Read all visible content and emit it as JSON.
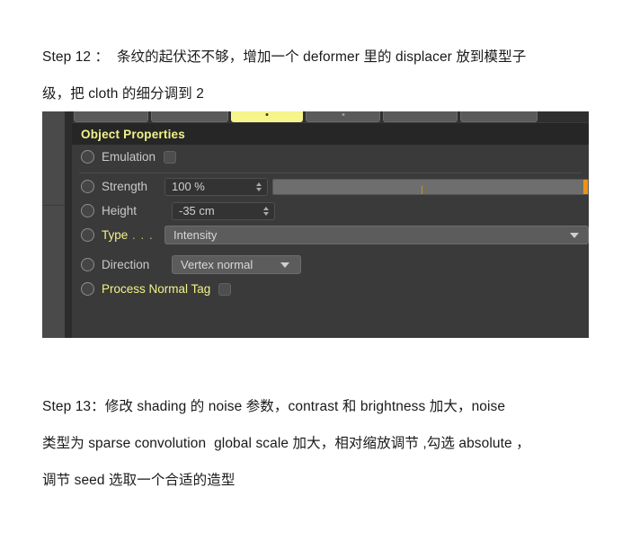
{
  "document": {
    "step12": "Step 12 ：  条纹的起伏还不够，增加一个 deformer 里的 displacer 放到模型子\n级，把 cloth 的细分调到 2",
    "step13": "Step 13：修改 shading 的 noise 参数，contrast 和 brightness 加大，noise\n类型为 sparse convolution  global scale 加大，相对缩放调节 ,勾选 absolute ，\n调节 seed 选取一个合适的造型"
  },
  "panel": {
    "section_title": "Object Properties",
    "tabs": [
      {
        "name": "tab-1",
        "active": false,
        "marker": "none"
      },
      {
        "name": "tab-2",
        "active": false,
        "marker": "none"
      },
      {
        "name": "tab-3",
        "active": true,
        "marker": "dark-dot"
      },
      {
        "name": "tab-4",
        "active": false,
        "marker": "light-dot"
      },
      {
        "name": "tab-5",
        "active": false,
        "marker": "none"
      },
      {
        "name": "tab-6",
        "active": false,
        "marker": "none"
      }
    ],
    "rows": {
      "emulation": {
        "label": "Emulation",
        "checkbox_checked": false,
        "icon": "animation-track-circle-icon"
      },
      "strength": {
        "label": "Strength",
        "value": "100 %",
        "slider_percent": 100,
        "icon": "animation-track-circle-icon"
      },
      "height": {
        "label": "Height",
        "value": "-35 cm",
        "icon": "animation-track-circle-icon"
      },
      "type": {
        "label": "Type",
        "label_suffix_dots": true,
        "value": "Intensity",
        "icon": "animation-track-circle-icon"
      },
      "direction": {
        "label": "Direction",
        "value": "Vertex normal",
        "icon": "animation-track-circle-icon"
      },
      "process_normal_tag": {
        "label": "Process Normal Tag",
        "checkbox_checked": false,
        "icon": "animation-track-circle-icon"
      }
    }
  },
  "colors": {
    "panel_bg": "#3a3a3a",
    "section_bar": "#262626",
    "accent_yellow": "#f2f289",
    "accent_orange": "#f0920f",
    "label_gray": "#c9c9c9",
    "page_bg": "#ffffff"
  }
}
